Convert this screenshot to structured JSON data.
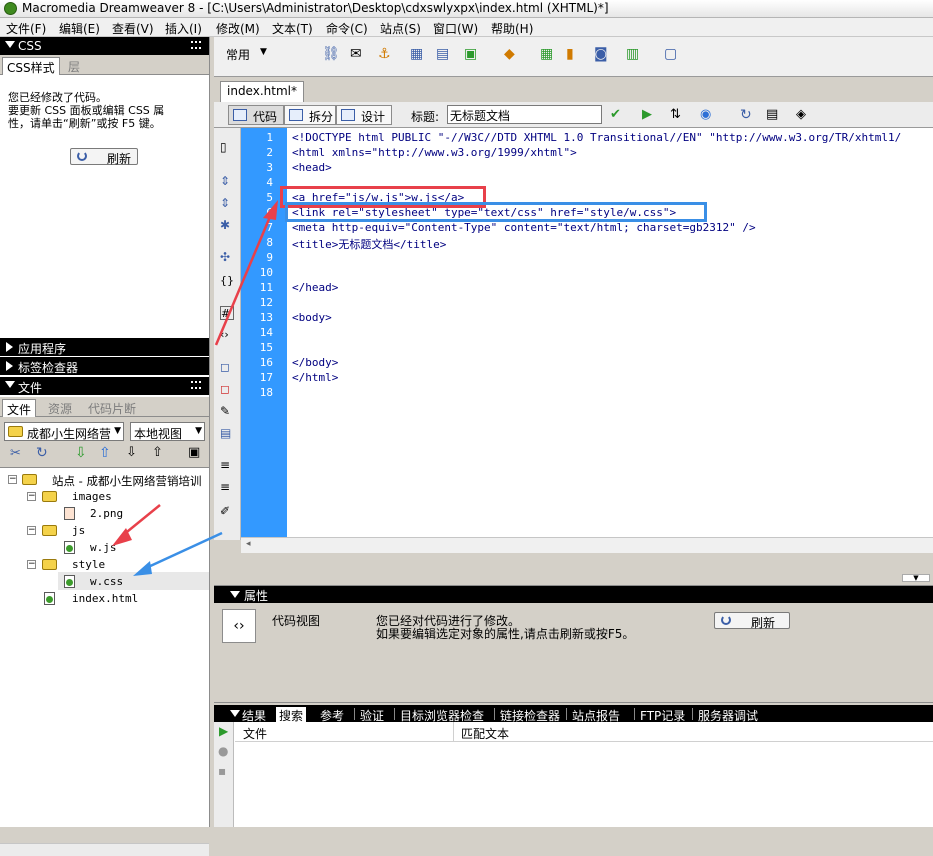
{
  "window": {
    "title": "Macromedia Dreamweaver 8 - [C:\\Users\\Administrator\\Desktop\\cdxswlyxpx\\index.html (XHTML)*]"
  },
  "menu": [
    "文件(F)",
    "编辑(E)",
    "查看(V)",
    "插入(I)",
    "修改(M)",
    "文本(T)",
    "命令(C)",
    "站点(S)",
    "窗口(W)",
    "帮助(H)"
  ],
  "css_panel": {
    "header": "CSS",
    "tabs": [
      "CSS样式",
      "层"
    ],
    "message_line1": "您已经修改了代码。",
    "message_line2": "要更新 CSS 面板或编辑 CSS 属",
    "message_line3": "性，请单击“刷新”或按 F5 键。",
    "refresh_label": "刷新"
  },
  "collapsed_panels": [
    "应用程序",
    "标签检查器"
  ],
  "files_panel": {
    "header": "文件",
    "tabs": [
      "文件",
      "资源",
      "代码片断"
    ],
    "site_select": "成都小生网络营",
    "view_select": "本地视图",
    "tree": {
      "site": "站点 - 成都小生网络营销培训",
      "images_folder": "images",
      "png_file": "2.png",
      "js_folder": "js",
      "js_file": "w.js",
      "style_folder": "style",
      "css_file": "w.css",
      "index_file": "index.html"
    }
  },
  "insert_bar": {
    "category": "常用"
  },
  "document": {
    "tab": "index.html*",
    "view_code": "代码",
    "view_split": "拆分",
    "view_design": "设计",
    "title_label": "标题:",
    "title_value": "无标题文档",
    "line_numbers": [
      "1",
      "2",
      "3",
      "4",
      "5",
      "6",
      "7",
      "8",
      "9",
      "10",
      "11",
      "12",
      "13",
      "14",
      "15",
      "16",
      "17",
      "18"
    ],
    "code_lines": [
      "<!DOCTYPE html PUBLIC \"-//W3C//DTD XHTML 1.0 Transitional//EN\" \"http://www.w3.org/TR/xhtml1/",
      "<html xmlns=\"http://www.w3.org/1999/xhtml\">",
      "<head>",
      "",
      "<a href=\"js/w.js\">w.js</a>",
      "<link rel=\"stylesheet\" type=\"text/css\" href=\"style/w.css\">",
      "<meta http-equiv=\"Content-Type\" content=\"text/html; charset=gb2312\" />",
      "<title>无标题文档</title>",
      "",
      "",
      "</head>",
      "",
      "<body>",
      "",
      "",
      "</body>",
      "</html>",
      ""
    ]
  },
  "properties": {
    "header": "属性",
    "mode_label": "代码视图",
    "msg_line1": "您已经对代码进行了修改。",
    "msg_line2": "如果要编辑选定对象的属性,请点击刷新或按F5。",
    "refresh_label": "刷新"
  },
  "results": {
    "header": "结果",
    "tabs": [
      "搜索",
      "参考",
      "验证",
      "目标浏览器检查",
      "链接检查器",
      "站点报告",
      "FTP记录",
      "服务器调试"
    ],
    "columns": [
      "文件",
      "匹配文本"
    ]
  },
  "colors": {
    "gutter": "#3399ff",
    "code_text": "#000080",
    "red_box": "#e8404a",
    "blue_box": "#3a8fe6"
  }
}
